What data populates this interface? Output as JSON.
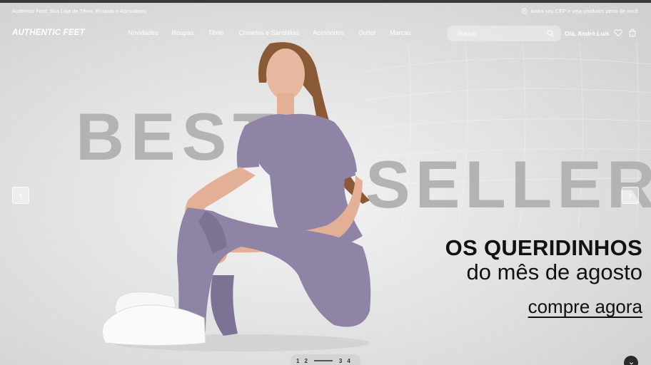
{
  "announcement": {
    "left_text": "Authentic Feet: Sua Loja de Tênis, Roupas e Acessórios",
    "cep_text": "Insira seu CEP e veja produtos perto de você"
  },
  "header": {
    "logo": "AUTHENTIC FEET",
    "menu": [
      "Novidades",
      "Roupas",
      "Tênis",
      "Chinelos e Sandálias",
      "Acessórios",
      "Outlet",
      "Marcas"
    ],
    "search_placeholder": "Buscar",
    "greeting": "Olá, André Luis"
  },
  "hero": {
    "word1": "BEST",
    "word2": "SELLERS",
    "headline": "OS QUERIDINHOS",
    "subline": "do mês de agosto",
    "cta": "compre agora"
  },
  "pager": {
    "pages": [
      "1",
      "2",
      "3",
      "4"
    ],
    "active": 2
  },
  "colors": {
    "text_dark": "#111111",
    "watermark": "#b3b3b3",
    "outfit": "#8f84a6"
  },
  "icons": [
    "location-pin-icon",
    "search-icon",
    "heart-icon",
    "bag-icon",
    "chevron-left-icon",
    "chevron-right-icon",
    "chevron-down-icon"
  ]
}
